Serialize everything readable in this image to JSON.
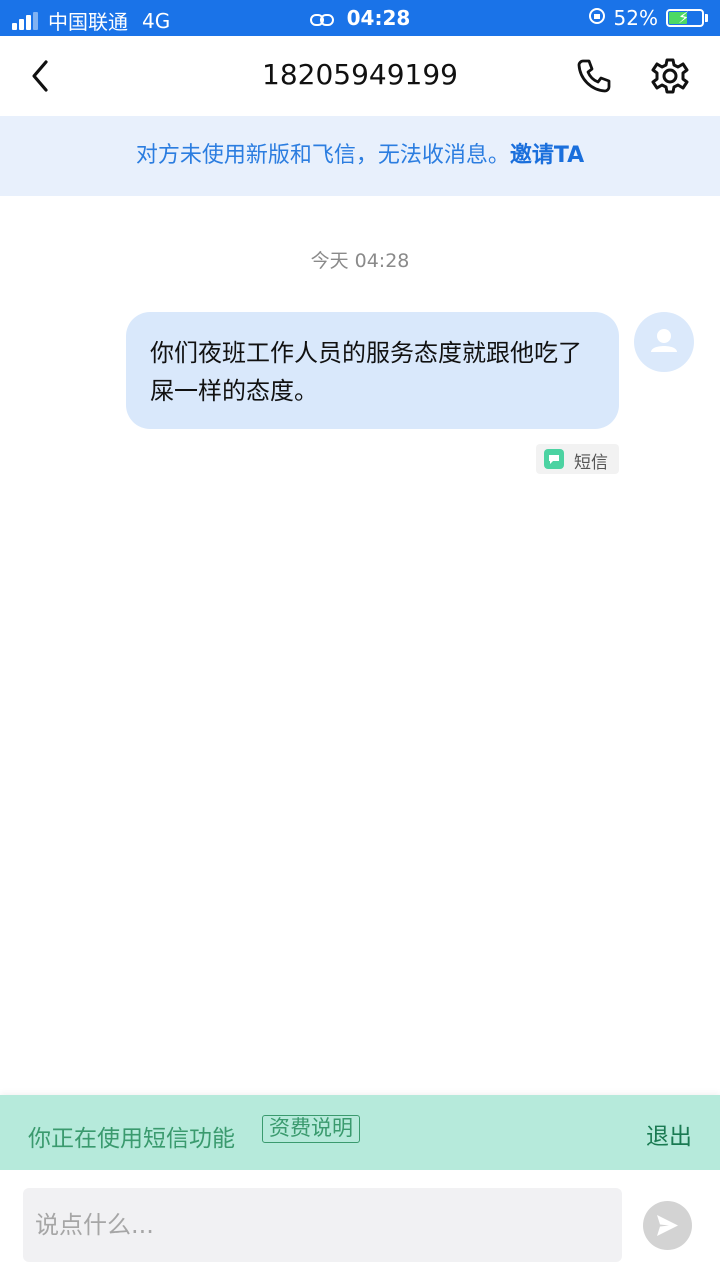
{
  "status_bar": {
    "carrier": "中国联通",
    "network": "4G",
    "time": "04:28",
    "battery": "52%",
    "battery_level": 0.52,
    "signal_bars": 3
  },
  "nav": {
    "title": "18205949199",
    "back_icon": "chevron-left-icon",
    "call_icon": "phone-icon",
    "settings_icon": "gear-icon"
  },
  "invite_banner": {
    "message": "对方未使用新版和飞信，无法收消息。",
    "link": "邀请TA"
  },
  "chat": {
    "timestamp": "今天 04:28",
    "messages": [
      {
        "direction": "outgoing",
        "text": "你们夜班工作人员的服务态度就跟他吃了屎一样的态度。",
        "channel_tag": "短信"
      }
    ]
  },
  "sms_mode": {
    "text": "你正在使用短信功能",
    "tariff_link": "资费说明",
    "exit": "退出"
  },
  "composer": {
    "placeholder": "说点什么..."
  },
  "colors": {
    "status_bar": "#1a73e8",
    "banner_bg": "#e8f0fc",
    "banner_text": "#2b7de0",
    "bubble_bg": "#d9e8fb",
    "sms_bar_bg": "#b6eadb",
    "sms_bar_text": "#3a9a6e"
  }
}
